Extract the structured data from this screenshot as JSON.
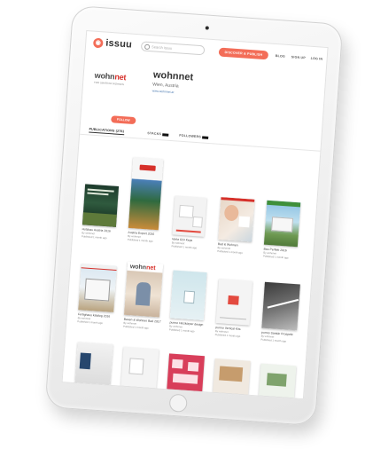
{
  "header": {
    "logo_text": "issuu",
    "search_placeholder": "Search issuu",
    "cta_label": "DISCOVER & PUBLISH",
    "nav": [
      "BLOG",
      "SIGN UP",
      "LOG IN"
    ]
  },
  "profile": {
    "brand_name_a": "wohn",
    "brand_name_b": "net",
    "brand_tagline": "FOR SMARTER WOHNEN",
    "title": "wohnnet",
    "location": "Wien, Austria",
    "url": "www.wohnnet.at",
    "follow_label": "FOLLOW"
  },
  "tabs": [
    "PUBLICATIONS (276)",
    "STACKS",
    "FOLLOWERS"
  ],
  "publications": [
    {
      "title": "Holzbau Austria 2016",
      "meta_1": "By wohnnet",
      "meta_2": "Published 1 month ago"
    },
    {
      "title": "Austria Export 2016",
      "meta_1": "By wohnnet",
      "meta_2": "Published 1 month ago"
    },
    {
      "title": "Varta GSI Keys",
      "meta_1": "By wohnnet",
      "meta_2": "Published 1 month ago"
    },
    {
      "title": "Bad & Wohnen",
      "meta_1": "By wohnnet",
      "meta_2": "Published 1 month ago"
    },
    {
      "title": "Bau Perfekt 2016",
      "meta_1": "By wohnnet",
      "meta_2": "Published 1 month ago"
    },
    {
      "title": "Fertighaus katalog 2016",
      "meta_1": "By wohnnet",
      "meta_2": "Published 1 month ago"
    },
    {
      "title": "Bauen & Wohnen Bad 2017",
      "meta_1": "By wohnnet",
      "meta_2": "Published 1 month ago"
    },
    {
      "title": "purmo Heizkörper design",
      "meta_1": "By wohnnet",
      "meta_2": "Published 1 month ago"
    },
    {
      "title": "purmo Vertical Kits",
      "meta_1": "By wohnnet",
      "meta_2": "Published 1 month ago"
    },
    {
      "title": "purmo Sanitär Prospekt",
      "meta_1": "By wohnnet",
      "meta_2": "Published 1 month ago"
    }
  ],
  "cover_colors": {
    "accent": "#f36d58",
    "brand_red": "#d6302a"
  }
}
